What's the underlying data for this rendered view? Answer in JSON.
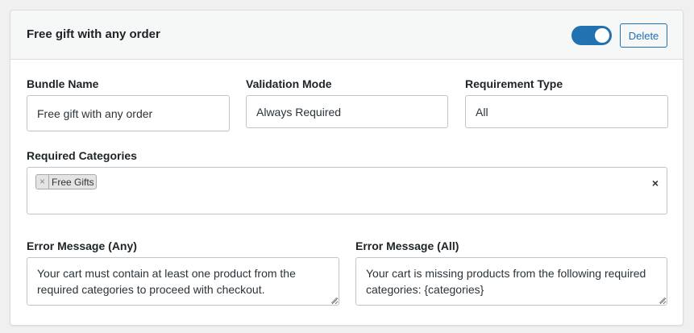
{
  "header": {
    "title": "Free gift with any order",
    "enabled": true,
    "delete_label": "Delete"
  },
  "fields": {
    "bundle_name": {
      "label": "Bundle Name",
      "value": "Free gift with any order"
    },
    "validation_mode": {
      "label": "Validation Mode",
      "value": "Always Required"
    },
    "requirement_type": {
      "label": "Requirement Type",
      "value": "All"
    },
    "required_categories": {
      "label": "Required Categories",
      "chips": [
        {
          "label": "Free Gifts",
          "remove_glyph": "×"
        }
      ],
      "clear_glyph": "×"
    },
    "error_any": {
      "label": "Error Message (Any)",
      "value": "Your cart must contain at least one product from the required categories to proceed with checkout."
    },
    "error_all": {
      "label": "Error Message (All)",
      "value": "Your cart is missing products from the following required categories: {categories}"
    }
  },
  "colors": {
    "accent": "#2271b1",
    "border": "#c3c4c7",
    "header_bg": "#f6f7f7"
  }
}
